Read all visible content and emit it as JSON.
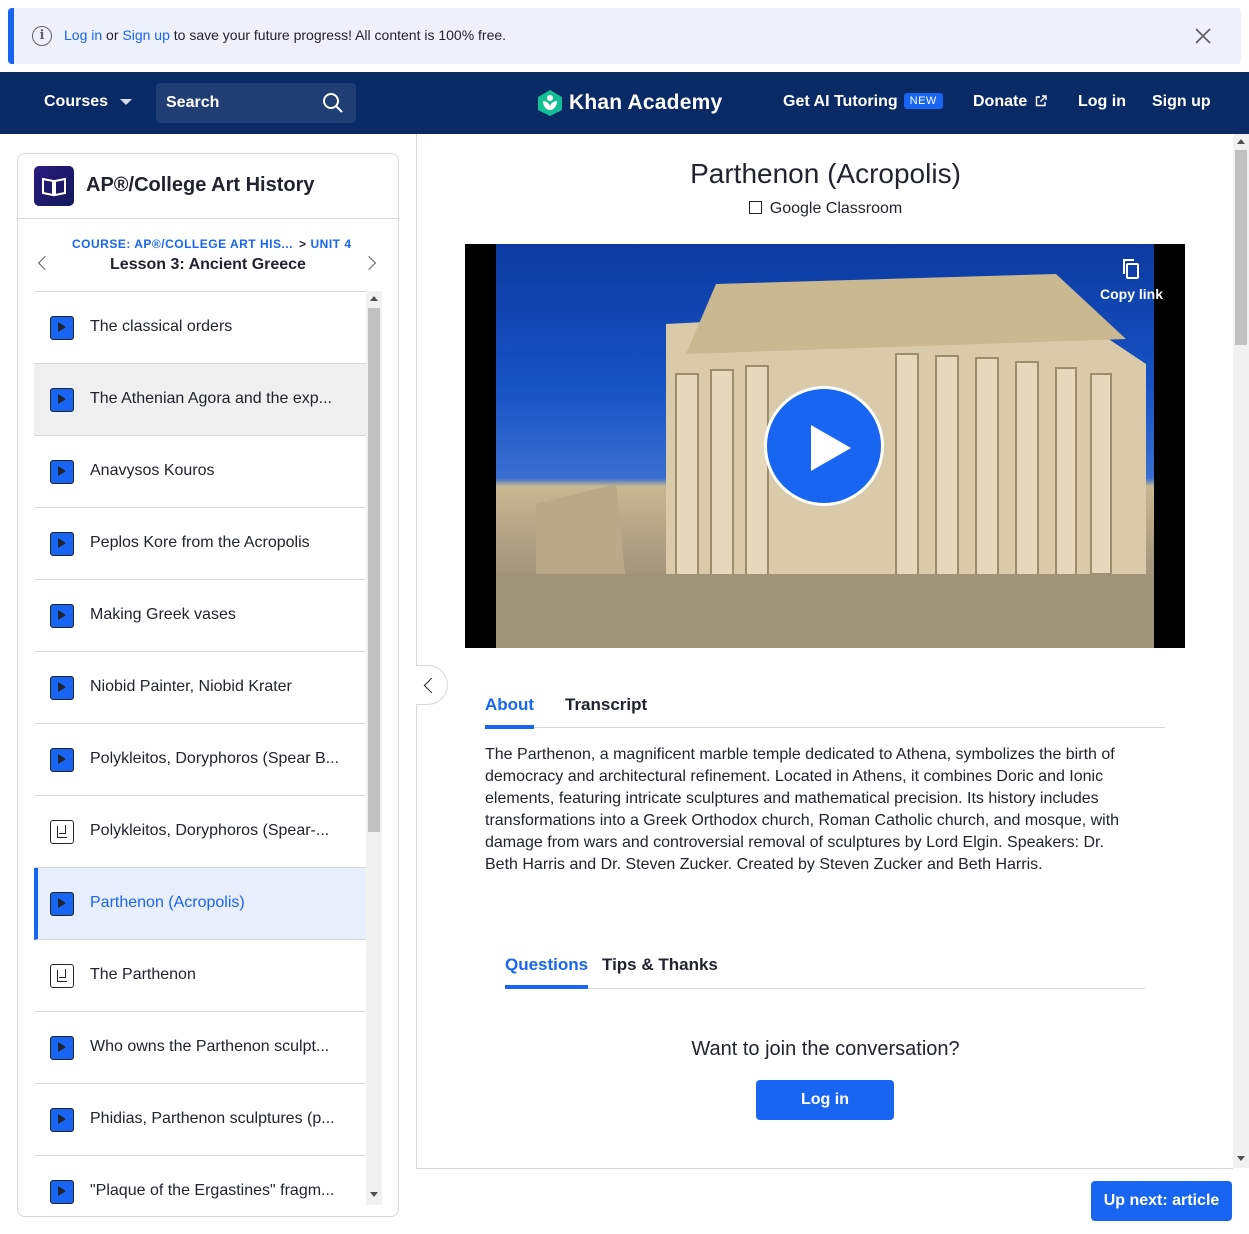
{
  "banner": {
    "login_link": "Log in",
    "or": "or",
    "signup_link": "Sign up",
    "message": "to save your future progress! All content is 100% free."
  },
  "nav": {
    "courses": "Courses",
    "search_label": "Search",
    "logo_text": "Khan Academy",
    "ai_tutoring": "Get AI Tutoring",
    "new_badge": "NEW",
    "donate": "Donate",
    "login": "Log in",
    "signup": "Sign up"
  },
  "sidebar": {
    "course_title": "AP®/College Art History",
    "crumb_course": "COURSE: AP®/COLLEGE ART HIS...",
    "crumb_sep": ">",
    "crumb_unit": "UNIT 4",
    "lesson_title": "Lesson 3: Ancient Greece",
    "items": [
      {
        "label": "The classical orders",
        "type": "video"
      },
      {
        "label": "The Athenian Agora and the exp...",
        "type": "video"
      },
      {
        "label": "Anavysos Kouros",
        "type": "video"
      },
      {
        "label": "Peplos Kore from the Acropolis",
        "type": "video"
      },
      {
        "label": "Making Greek vases",
        "type": "video"
      },
      {
        "label": "Niobid Painter, Niobid Krater",
        "type": "video"
      },
      {
        "label": "Polykleitos, Doryphoros (Spear B...",
        "type": "video"
      },
      {
        "label": "Polykleitos, Doryphoros (Spear-...",
        "type": "article"
      },
      {
        "label": "Parthenon (Acropolis)",
        "type": "video"
      },
      {
        "label": "The Parthenon",
        "type": "article"
      },
      {
        "label": "Who owns the Parthenon sculpt...",
        "type": "video"
      },
      {
        "label": "Phidias, Parthenon sculptures (p...",
        "type": "video"
      },
      {
        "label": "\"Plaque of the Ergastines\" fragm...",
        "type": "video"
      }
    ]
  },
  "main": {
    "title": "Parthenon (Acropolis)",
    "google_classroom": "Google Classroom",
    "copy_link": "Copy link",
    "tab_about": "About",
    "tab_transcript": "Transcript",
    "description": "The Parthenon, a magnificent marble temple dedicated to Athena, symbolizes the birth of democracy and architectural refinement. Located in Athens, it combines Doric and Ionic elements, featuring intricate sculptures and mathematical precision. Its history includes transformations into a Greek Orthodox church, Roman Catholic church, and mosque, with damage from wars and controversial removal of sculptures by Lord Elgin. Speakers: Dr. Beth Harris and Dr. Steven Zucker. Created by Steven Zucker and Beth Harris.",
    "tab_questions": "Questions",
    "tab_tips": "Tips & Thanks",
    "join_heading": "Want to join the conversation?",
    "login_button": "Log in",
    "up_next": "Up next: article"
  },
  "colors": {
    "accent": "#1865f2",
    "nav_bg": "#0a2a66",
    "logo_green": "#14bf96"
  }
}
